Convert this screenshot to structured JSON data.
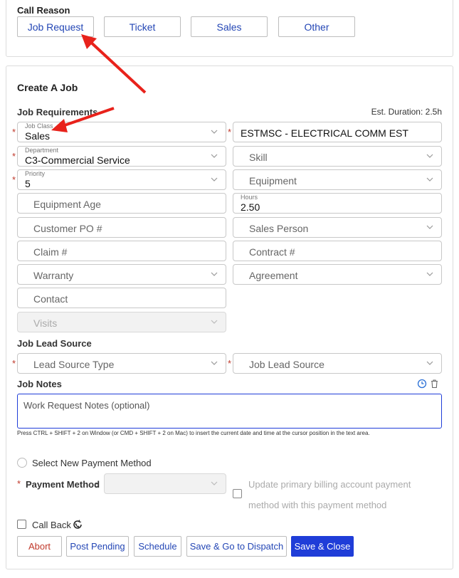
{
  "call_reason": {
    "title": "Call Reason",
    "buttons": [
      "Job Request",
      "Ticket",
      "Sales",
      "Other"
    ]
  },
  "create_job": {
    "title": "Create A Job",
    "requirements_title": "Job Requirements",
    "est_duration": "Est. Duration: 2.5h",
    "job_class": {
      "label": "Job Class",
      "value": "Sales"
    },
    "estmsc": {
      "value": "ESTMSC - ELECTRICAL COMM EST"
    },
    "department": {
      "label": "Department",
      "value": "C3-Commercial Service"
    },
    "skill": {
      "placeholder": "Skill"
    },
    "priority": {
      "label": "Priority",
      "value": "5"
    },
    "equipment": {
      "placeholder": "Equipment"
    },
    "equipment_age": {
      "placeholder": "Equipment Age"
    },
    "hours": {
      "label": "Hours",
      "value": "2.50"
    },
    "customer_po": {
      "placeholder": "Customer PO #"
    },
    "sales_person": {
      "placeholder": "Sales Person"
    },
    "claim": {
      "placeholder": "Claim #"
    },
    "contract": {
      "placeholder": "Contract #"
    },
    "warranty": {
      "placeholder": "Warranty"
    },
    "agreement": {
      "placeholder": "Agreement"
    },
    "contact": {
      "placeholder": "Contact"
    },
    "visits": {
      "placeholder": "Visits"
    },
    "lead_source_title": "Job Lead Source",
    "lead_source_type": {
      "placeholder": "Lead Source Type"
    },
    "lead_source": {
      "placeholder": "Job Lead Source"
    },
    "notes_title": "Job Notes",
    "notes_placeholder": "Work Request Notes (optional)",
    "notes_hint": "Press CTRL + SHIFT + 2 on Window (or CMD + SHIFT + 2 on Mac) to insert the current date and time at the cursor position in the text area.",
    "select_payment": "Select New Payment Method",
    "payment_method_label": "Payment Method",
    "update_billing_line1": "Update primary billing account payment",
    "update_billing_line2": "method with this payment method",
    "call_back": "Call Back"
  },
  "actions": [
    "Abort",
    "Post Pending",
    "Schedule",
    "Save & Go to Dispatch",
    "Save & Close"
  ],
  "colors": {
    "accent": "#1f3dd8",
    "link": "#2346b5",
    "required": "#c0392b",
    "annotation": "#e8221b"
  }
}
